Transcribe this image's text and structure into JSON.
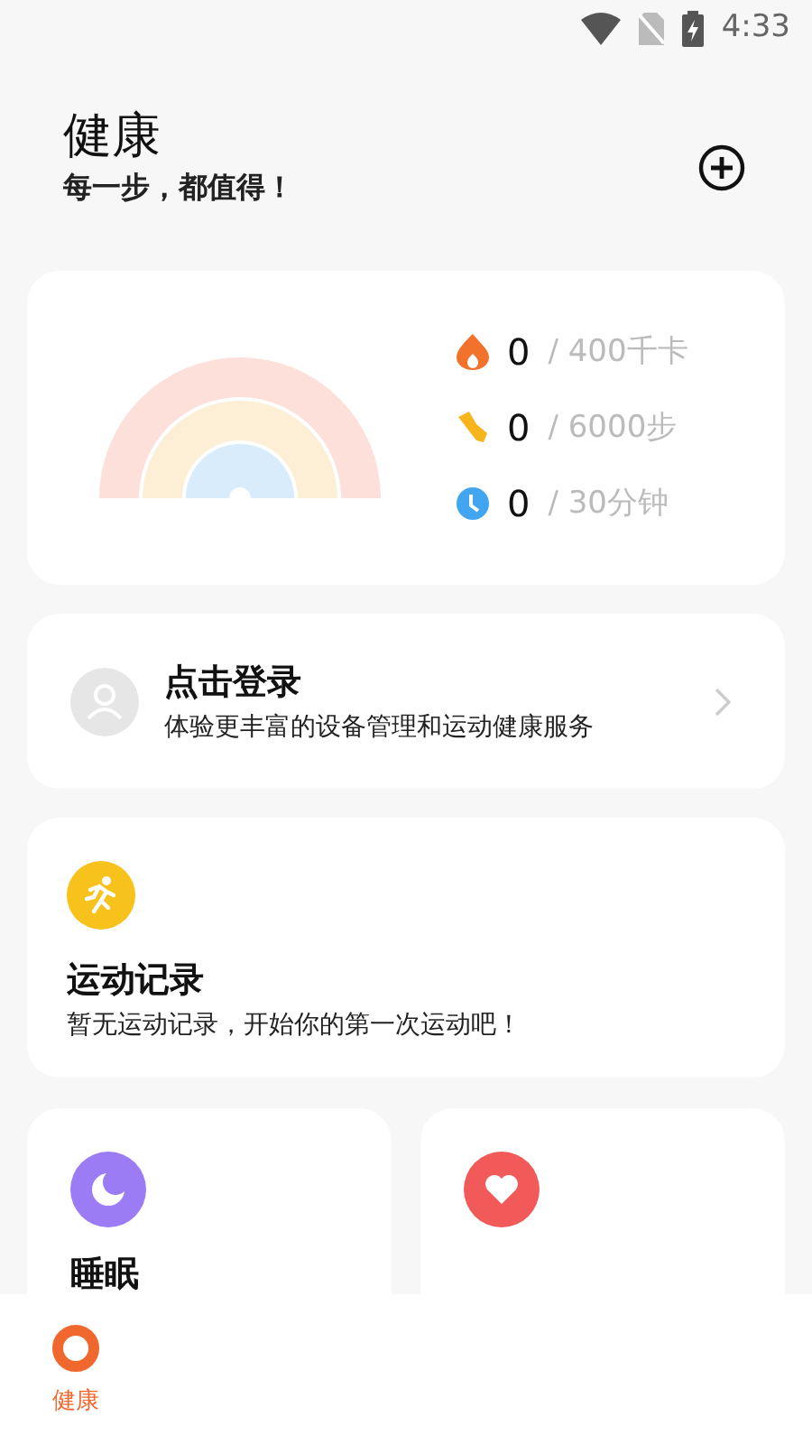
{
  "status_bar": {
    "time": "4:33"
  },
  "header": {
    "title": "健康",
    "subtitle": "每一步，都值得！"
  },
  "goals": [
    {
      "kind": "calories",
      "value": "0",
      "target": "/ 400千卡"
    },
    {
      "kind": "steps",
      "value": "0",
      "target": "/ 6000步"
    },
    {
      "kind": "duration",
      "value": "0",
      "target": "/ 30分钟"
    }
  ],
  "login": {
    "title": "点击登录",
    "subtitle": "体验更丰富的设备管理和运动健康服务"
  },
  "workout": {
    "title": "运动记录",
    "subtitle": "暂无运动记录，开始你的第一次运动吧！"
  },
  "tiles": [
    {
      "kind": "sleep",
      "title": "睡眠"
    },
    {
      "kind": "heart"
    }
  ],
  "bottom_nav": [
    {
      "label": "健康",
      "selected": true
    }
  ]
}
